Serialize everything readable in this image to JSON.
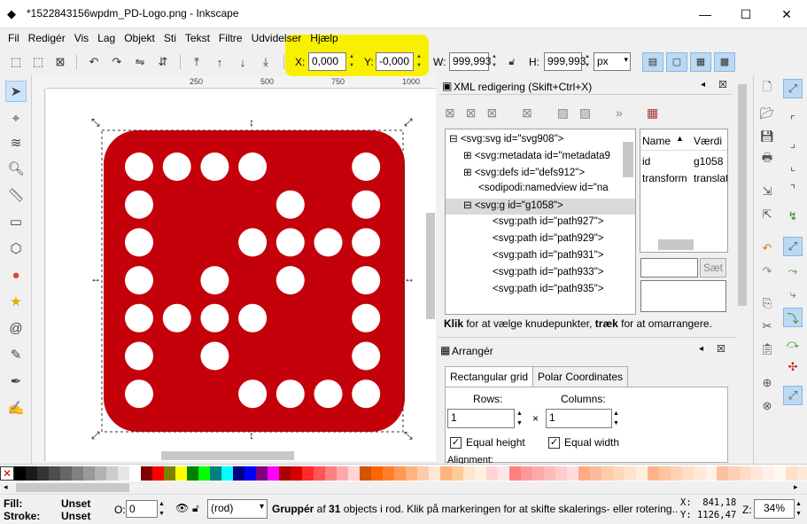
{
  "window": {
    "title": "*1522843156wpdm_PD-Logo.png - Inkscape",
    "minimize": "—",
    "maximize": "☐",
    "close": "✕"
  },
  "menu": [
    "Fil",
    "Redigér",
    "Vis",
    "Lag",
    "Objekt",
    "Sti",
    "Tekst",
    "Filtre",
    "Udvidelser",
    "Hjælp"
  ],
  "toolbar": {
    "x_label": "X:",
    "x_value": "0,000",
    "y_label": "Y:",
    "y_value": "-0,000",
    "w_label": "W:",
    "w_value": "999,993",
    "h_label": "H:",
    "h_value": "999,993",
    "unit": "px"
  },
  "ruler_labels": [
    "250",
    "500",
    "750",
    "1000"
  ],
  "xml_editor": {
    "title": "XML redigering  (Skift+Ctrl+X)",
    "nodes": [
      {
        "toggle": "⊟",
        "text": "<svg:svg id=\"svg908\">"
      },
      {
        "toggle": "⊞",
        "text": "<svg:metadata id=\"metadata9"
      },
      {
        "toggle": "⊞",
        "text": "<svg:defs id=\"defs912\">"
      },
      {
        "toggle": "",
        "text": "<sodipodi:namedview id=\"na"
      },
      {
        "toggle": "⊟",
        "text": "<svg:g id=\"g1058\">"
      },
      {
        "toggle": "",
        "text": "<svg:path id=\"path927\">"
      },
      {
        "toggle": "",
        "text": "<svg:path id=\"path929\">"
      },
      {
        "toggle": "",
        "text": "<svg:path id=\"path931\">"
      },
      {
        "toggle": "",
        "text": "<svg:path id=\"path933\">"
      },
      {
        "toggle": "",
        "text": "<svg:path id=\"path935\">"
      }
    ],
    "attr_headers": {
      "name": "Name",
      "value": "Værdi"
    },
    "attrs": [
      {
        "name": "id",
        "value": "g1058"
      },
      {
        "name": "transform",
        "value": "translat"
      }
    ],
    "set_button": "Sæt",
    "hint_bold1": "Klik",
    "hint_text1": " for at vælge knudepunkter, ",
    "hint_bold2": "træk",
    "hint_text2": " for at omarrangere."
  },
  "arrange": {
    "title": "Arrangér",
    "tab1": "Rectangular grid",
    "tab2": "Polar Coordinates",
    "rows_label": "Rows:",
    "rows_value": "1",
    "cols_label": "Columns:",
    "cols_value": "1",
    "times": "×",
    "equal_height": "Equal height",
    "equal_width": "Equal width",
    "alignment": "Alignment:"
  },
  "status": {
    "fill_label": "Fill:",
    "fill_value": "Unset",
    "stroke_label": "Stroke:",
    "stroke_value": "Unset",
    "opacity_label": "O:",
    "opacity_value": "0",
    "layer": "(rod)",
    "message_bold": "Gruppér",
    "message_mid": " af ",
    "message_bold2": "31",
    "message_rest": " objects i rod. Klik på markeringen for at skifte skalerings- eller rotering...",
    "x_coord": "X:  841,18",
    "y_coord": "Y: 1126,47",
    "zoom_label": "Z:",
    "zoom_value": "34%"
  },
  "colors": {
    "dice_red": "#c4000b",
    "highlight": "#f9f000",
    "selection_blue": "#bcd9f3"
  },
  "palette": [
    "#000000",
    "#1a1a1a",
    "#333333",
    "#4d4d4d",
    "#666666",
    "#808080",
    "#999999",
    "#b3b3b3",
    "#cccccc",
    "#e6e6e6",
    "#ffffff",
    "#800000",
    "#ff0000",
    "#808000",
    "#ffff00",
    "#008000",
    "#00ff00",
    "#008080",
    "#00ffff",
    "#000080",
    "#0000ff",
    "#800080",
    "#ff00ff",
    "#aa0000",
    "#d40000",
    "#ff2a2a",
    "#ff5555",
    "#ff8080",
    "#ffaaaa",
    "#ffd5d5",
    "#d45500",
    "#ff6600",
    "#ff7f2a",
    "#ff9955",
    "#ffb380",
    "#ffccaa",
    "#ffe6d5"
  ]
}
